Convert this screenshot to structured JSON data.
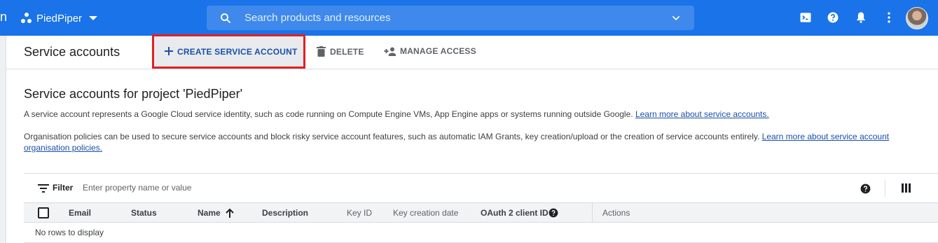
{
  "topbar": {
    "project_name": "PiedPiper",
    "search_placeholder": "Search products and resources",
    "partial_text": "n"
  },
  "header": {
    "title": "Service accounts",
    "actions": {
      "create_label": "CREATE SERVICE ACCOUNT",
      "delete_label": "DELETE",
      "manage_access_label": "MANAGE ACCESS"
    }
  },
  "main": {
    "heading": "Service accounts for project 'PiedPiper'",
    "description_1": "A service account represents a Google Cloud service identity, such as code running on Compute Engine VMs, App Engine apps or systems running outside Google.",
    "description_1_link": "Learn more about service accounts.",
    "description_2": "Organisation policies can be used to secure service accounts and block risky service account features, such as automatic IAM Grants, key creation/upload or the creation of service accounts entirely.",
    "description_2_link": "Learn more about service account organisation policies."
  },
  "table": {
    "filter_label": "Filter",
    "filter_placeholder": "Enter property name or value",
    "columns": [
      "Email",
      "Status",
      "Name",
      "Description",
      "Key ID",
      "Key creation date",
      "OAuth 2 client ID",
      "Actions"
    ],
    "empty_message": "No rows to display",
    "sort_column": "Name",
    "sort_direction": "ascending"
  },
  "colors": {
    "topbar": "#1a73e8",
    "highlight_border": "#e02020",
    "link": "#1a4fa8"
  }
}
